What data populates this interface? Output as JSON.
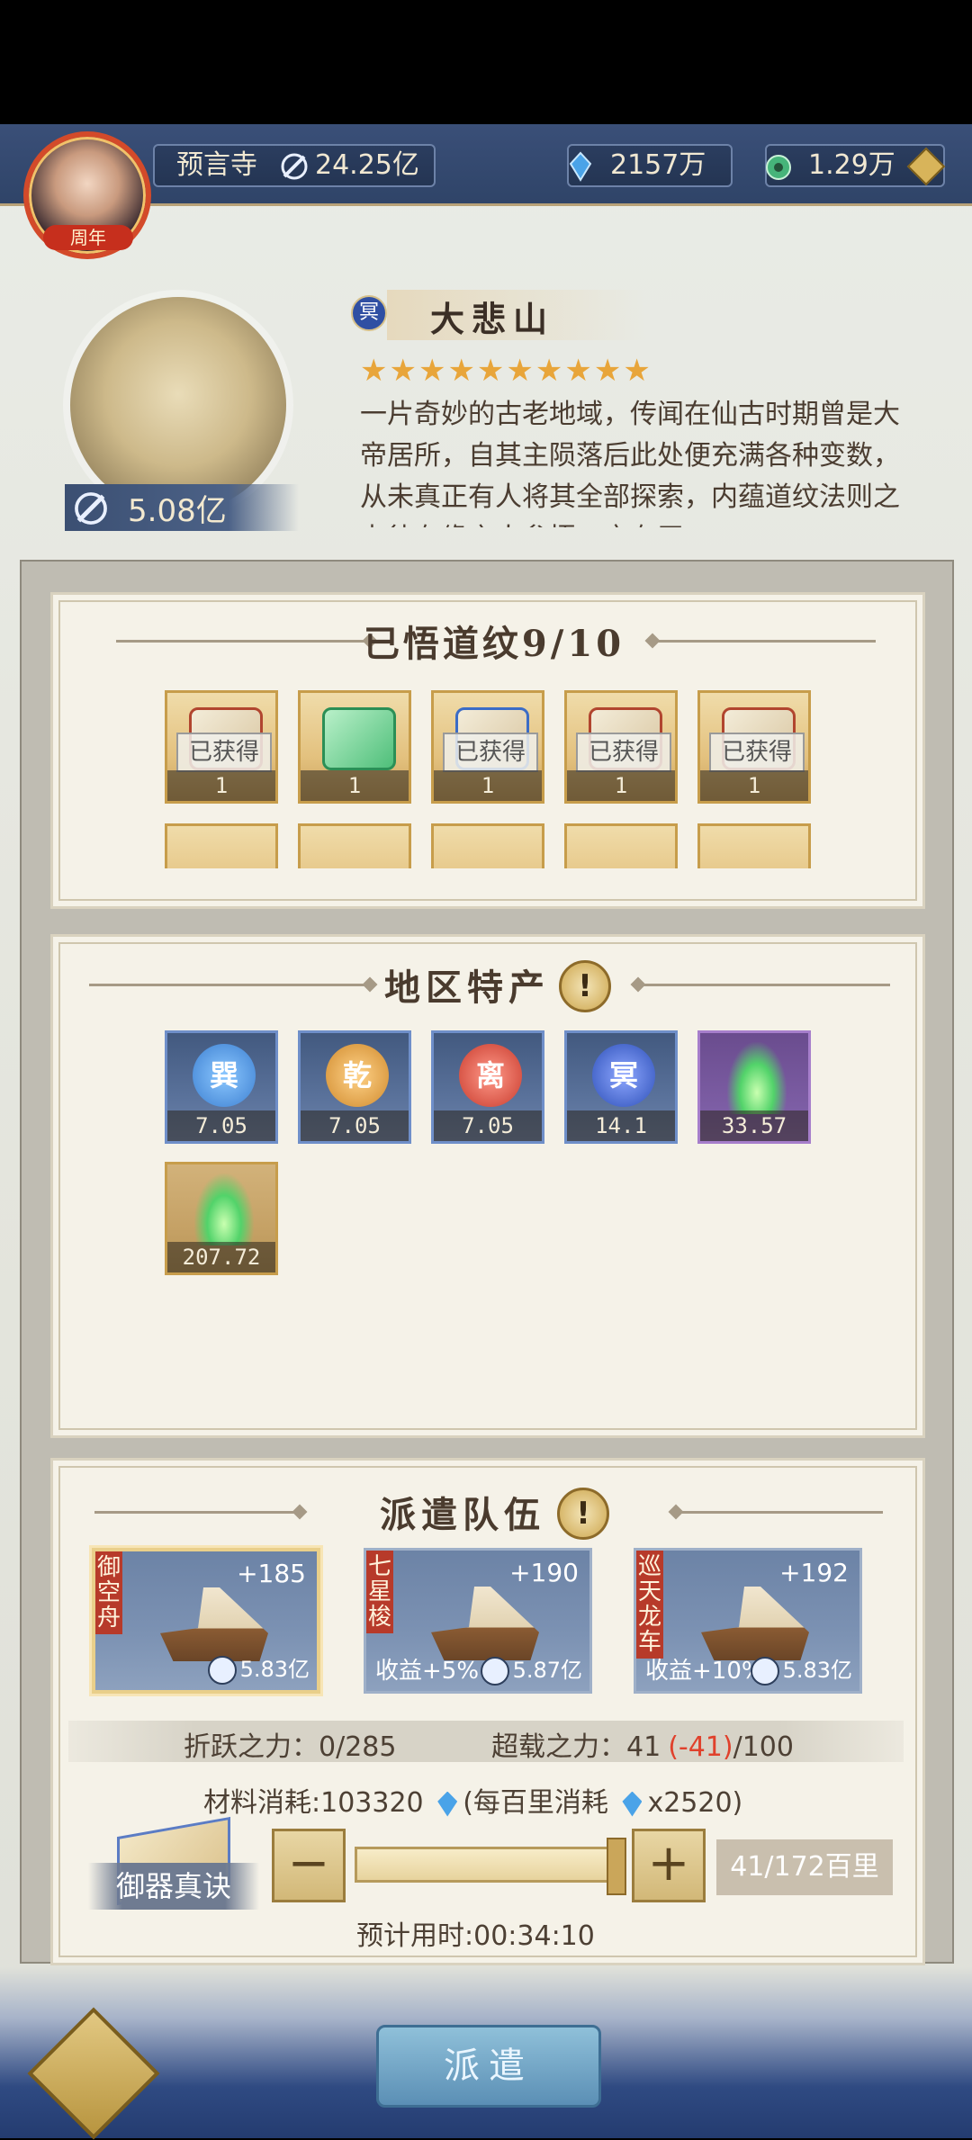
{
  "header": {
    "location": "预言寺",
    "power": "24.25亿",
    "crystals": "2157万",
    "jade": "1.29万",
    "avatar_badge": "周年"
  },
  "region": {
    "name": "大悲山",
    "badge": "冥",
    "stars": "★★★★★★★★★★",
    "star_count": 10,
    "description": "一片奇妙的古老地域，传闻在仙古时期曾是大帝居所，自其主陨落后此处便充满各种变数，从未真正有人将其全部探索，内蕴道纹法则之力待有缘之人参悟，亦有无",
    "power": "5.08亿"
  },
  "dao_panel": {
    "title": "已悟道纹9/10",
    "items": [
      {
        "label": "已获得",
        "count": "1",
        "style": "red"
      },
      {
        "label": "",
        "count": "1",
        "style": "green"
      },
      {
        "label": "已获得",
        "count": "1",
        "style": "blue"
      },
      {
        "label": "已获得",
        "count": "1",
        "style": "red"
      },
      {
        "label": "已获得",
        "count": "1",
        "style": "red"
      }
    ]
  },
  "specialty_panel": {
    "title": "地区特产",
    "info": "!",
    "items": [
      {
        "glyph": "巽",
        "value": "7.05",
        "color": "#3c7fd1"
      },
      {
        "glyph": "乾",
        "value": "7.05",
        "color": "#d08a2c"
      },
      {
        "glyph": "离",
        "value": "7.05",
        "color": "#c83a2c"
      },
      {
        "glyph": "冥",
        "value": "14.1",
        "color": "#2c4fb8"
      },
      {
        "glyph": "",
        "value": "33.57",
        "color": "#6a4c8e"
      },
      {
        "glyph": "",
        "value": "207.72",
        "color": "#c5a165"
      }
    ]
  },
  "dispatch_panel": {
    "title": "派遣队伍",
    "info": "!",
    "ships": [
      {
        "name": "御空舟",
        "plus": "+185",
        "bonus": "",
        "value": "5.83亿"
      },
      {
        "name": "七星梭",
        "plus": "+190",
        "bonus": "收益+5%",
        "value": "5.87亿"
      },
      {
        "name": "巡天龙车",
        "plus": "+192",
        "bonus": "收益+10%",
        "value": "5.83亿"
      }
    ],
    "fold_power_label": "折跃之力：",
    "fold_power_value": "0/285",
    "overload_label": "超载之力：",
    "overload_value": "41",
    "overload_delta": "(-41)",
    "overload_max": "/100",
    "material_label": "材料消耗:",
    "material_value": "103320",
    "per_label": "(每百里消耗",
    "per_value": "x2520)",
    "book_label": "御器真诀",
    "minus": "−",
    "plus": "+",
    "distance": "41/172百里",
    "slider_fill": 1.0,
    "time_label": "预计用时:",
    "time_value": "00:34:10"
  },
  "bottom": {
    "dispatch_button": "派遣"
  },
  "colors": {
    "accent_red": "#e0412c",
    "panel_bg": "#f5f2e8",
    "bar_blue": "#2f4468"
  }
}
